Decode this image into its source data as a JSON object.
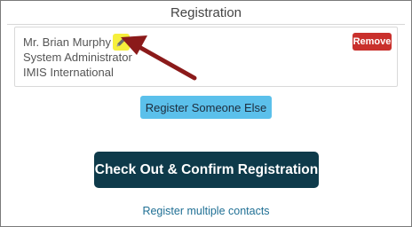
{
  "header": {
    "title": "Registration"
  },
  "registrant": {
    "name": "Mr. Brian Murphy",
    "role": "System Administrator",
    "organization": "IMIS International",
    "edit_icon": "pencil-icon",
    "remove_label": "Remove"
  },
  "actions": {
    "register_someone_else": "Register Someone Else",
    "checkout": "Check Out & Confirm Registration",
    "register_multiple": "Register multiple contacts"
  },
  "colors": {
    "remove": "#c9302c",
    "register_else": "#5bc0eb",
    "checkout": "#0e3a4a",
    "link": "#1f6f94",
    "highlight": "#f6ef3c",
    "annotation_arrow": "#8b1a1a"
  }
}
